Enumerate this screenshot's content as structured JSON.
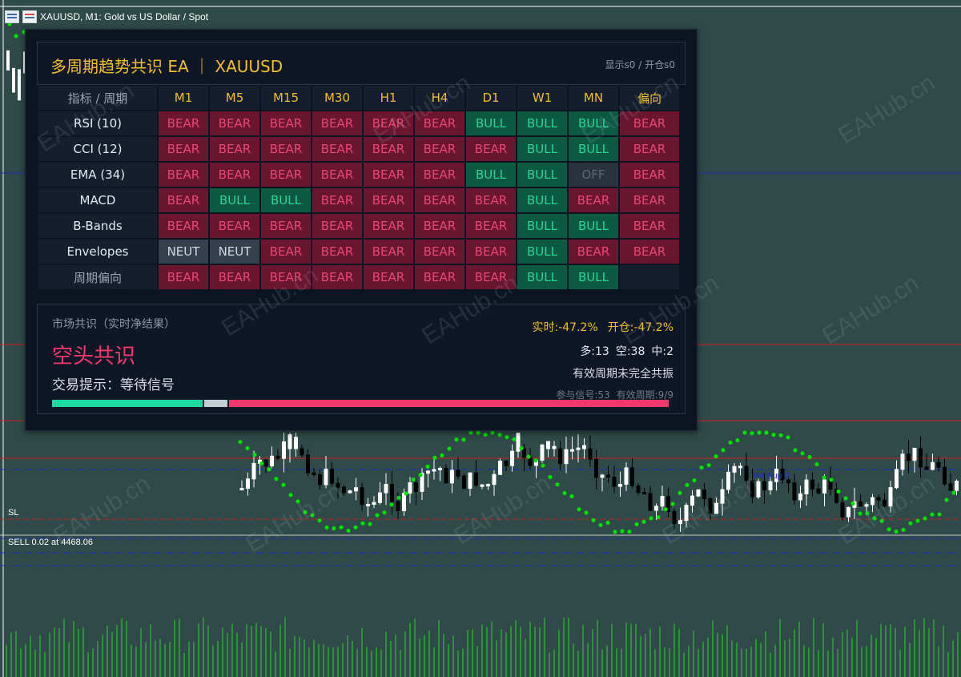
{
  "window": {
    "title": "XAUUSD, M1:  Gold vs US Dollar / Spot"
  },
  "panel": {
    "title": "多周期趋势共识 EA ｜ XAUUSD",
    "status": "显示s0 / 开仓s0",
    "header_label": "指标 / 周期",
    "periods": [
      "M1",
      "M5",
      "M15",
      "M30",
      "H1",
      "H4",
      "D1",
      "W1",
      "MN"
    ],
    "bias_label": "偏向",
    "rows": [
      {
        "name": "RSI (10)",
        "cells": [
          "BEAR",
          "BEAR",
          "BEAR",
          "BEAR",
          "BEAR",
          "BEAR",
          "BULL",
          "BULL",
          "BULL"
        ],
        "bias": "BEAR"
      },
      {
        "name": "CCI (12)",
        "cells": [
          "BEAR",
          "BEAR",
          "BEAR",
          "BEAR",
          "BEAR",
          "BEAR",
          "BEAR",
          "BULL",
          "BULL"
        ],
        "bias": "BEAR"
      },
      {
        "name": "EMA (34)",
        "cells": [
          "BEAR",
          "BEAR",
          "BEAR",
          "BEAR",
          "BEAR",
          "BEAR",
          "BULL",
          "BULL",
          "OFF"
        ],
        "bias": "BEAR"
      },
      {
        "name": "MACD",
        "cells": [
          "BEAR",
          "BULL",
          "BULL",
          "BEAR",
          "BEAR",
          "BEAR",
          "BEAR",
          "BULL",
          "BEAR"
        ],
        "bias": "BEAR"
      },
      {
        "name": "B-Bands",
        "cells": [
          "BEAR",
          "BEAR",
          "BEAR",
          "BEAR",
          "BEAR",
          "BEAR",
          "BEAR",
          "BULL",
          "BULL"
        ],
        "bias": "BEAR"
      },
      {
        "name": "Envelopes",
        "cells": [
          "NEUT",
          "NEUT",
          "BEAR",
          "BEAR",
          "BEAR",
          "BEAR",
          "BEAR",
          "BULL",
          "BEAR"
        ],
        "bias": "BEAR"
      },
      {
        "name": "周期偏向",
        "cells": [
          "BEAR",
          "BEAR",
          "BEAR",
          "BEAR",
          "BEAR",
          "BEAR",
          "BEAR",
          "BULL",
          "BULL"
        ],
        "bias": ""
      }
    ],
    "summary": {
      "title": "市场共识（实时净结果）",
      "consensus": "空头共识",
      "tip": "交易提示：等待信号",
      "realtime": "实时:-47.2%",
      "open": "开仓:-47.2%",
      "long": "多:13",
      "short": "空:38",
      "neutral": "中:2",
      "note": "有效周期未完全共振",
      "signals": "参与信号:53",
      "valid": "有效周期:9/9",
      "bar": {
        "bull": 13,
        "neut": 2,
        "bear": 38
      }
    }
  },
  "chart": {
    "sl_label": "SL",
    "order_label": "SELL 0.02 at 4468.06",
    "h4_label": "H4 Sup 0",
    "colors": {
      "background": "#2f4a48",
      "up": "#ffffff",
      "down": "#000000",
      "sar": "#00e000",
      "volume": "#2bd42b",
      "red_line": "#d02020",
      "blue_line": "#1a2cc8"
    }
  },
  "watermark": "EAHub.cn"
}
